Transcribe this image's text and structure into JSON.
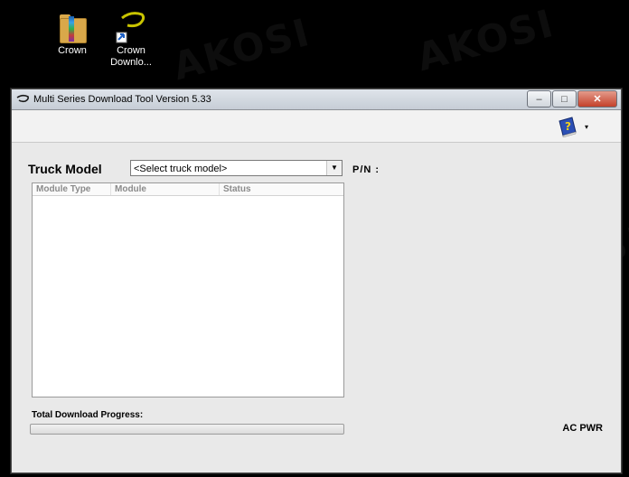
{
  "desktop": {
    "icons": [
      {
        "label": "Crown",
        "icon": "winrar-archive-icon"
      },
      {
        "label": "Crown Downlo...",
        "icon": "crown-shortcut-icon"
      }
    ]
  },
  "window": {
    "title": "Multi Series Download Tool Version 5.33",
    "controls": {
      "minimize": "–",
      "maximize": "□",
      "close": "✕"
    }
  },
  "toolbar": {
    "help_icon": "help-book-icon",
    "dropdown_glyph": "▾"
  },
  "form": {
    "truck_model_label": "Truck Model",
    "truck_model_selected": "<Select truck model>",
    "pn_label": "P/N :"
  },
  "table": {
    "columns": [
      "Module Type",
      "Module",
      "Status"
    ],
    "rows": []
  },
  "progress": {
    "label": "Total Download Progress:",
    "value": 0
  },
  "status": {
    "power": "AC PWR"
  },
  "watermark": "AKOSI"
}
